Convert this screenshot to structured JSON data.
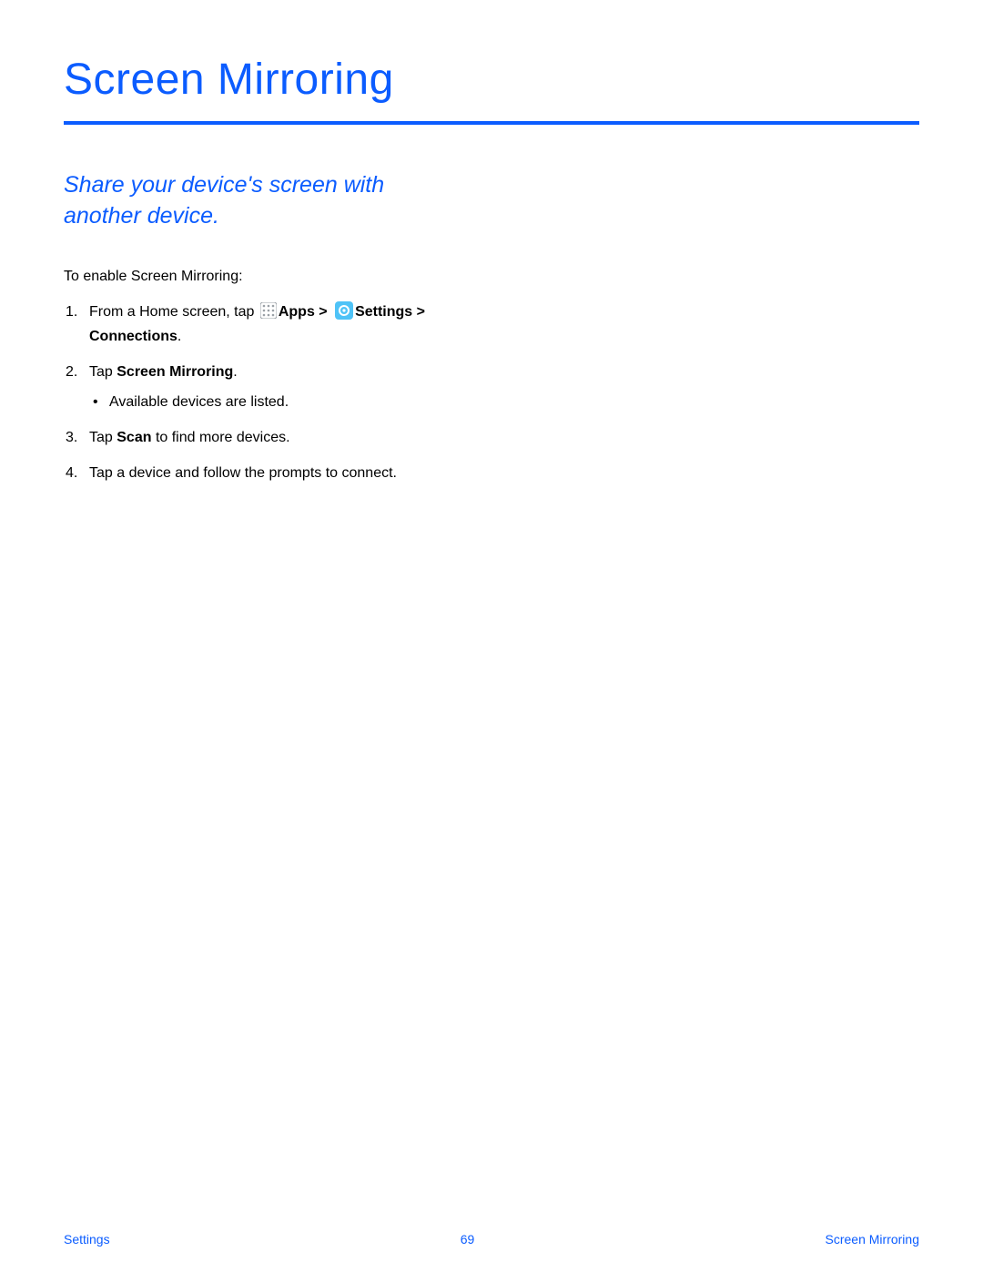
{
  "title": "Screen Mirroring",
  "subtitle": "Share your device's screen with another device.",
  "intro": "To enable Screen Mirroring:",
  "steps": {
    "s1_prefix": "From a Home screen, tap ",
    "s1_apps": "Apps",
    "s1_sep": " > ",
    "s1_settings": "Settings",
    "s1_tail": " > Connections",
    "s1_period": ".",
    "s2_prefix": "Tap ",
    "s2_bold": "Screen Mirroring",
    "s2_period": ".",
    "s2_sub1": "Available devices are listed.",
    "s3_prefix": "Tap ",
    "s3_bold": "Scan",
    "s3_tail": " to find more devices.",
    "s4": "Tap a device and follow the prompts to connect."
  },
  "footer": {
    "left": "Settings",
    "center": "69",
    "right": "Screen Mirroring"
  }
}
